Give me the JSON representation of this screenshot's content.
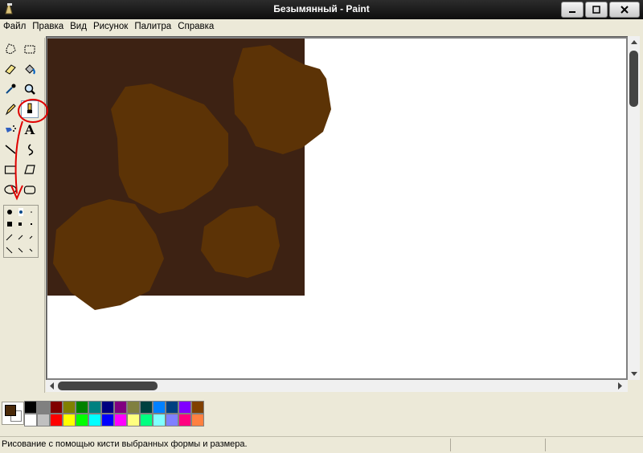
{
  "window": {
    "title": "Безымянный - Paint",
    "icons": {
      "app": "paint-app-icon",
      "minimize": "minimize-icon",
      "maximize": "maximize-icon",
      "close": "close-icon"
    }
  },
  "menu": [
    "Файл",
    "Правка",
    "Вид",
    "Рисунок",
    "Палитра",
    "Справка"
  ],
  "tools": [
    {
      "name": "free-form-select",
      "icon": "free-form-select-icon"
    },
    {
      "name": "select",
      "icon": "rectangle-select-icon"
    },
    {
      "name": "eraser",
      "icon": "eraser-icon"
    },
    {
      "name": "fill",
      "icon": "paint-bucket-icon"
    },
    {
      "name": "pick-color",
      "icon": "eyedropper-icon"
    },
    {
      "name": "magnifier",
      "icon": "magnifier-icon"
    },
    {
      "name": "pencil",
      "icon": "pencil-icon"
    },
    {
      "name": "brush",
      "icon": "brush-icon",
      "selected": true
    },
    {
      "name": "airbrush",
      "icon": "airbrush-icon"
    },
    {
      "name": "text",
      "icon": "text-icon",
      "glyph": "A"
    },
    {
      "name": "line",
      "icon": "line-icon"
    },
    {
      "name": "curve",
      "icon": "curve-icon"
    },
    {
      "name": "rectangle",
      "icon": "rectangle-icon"
    },
    {
      "name": "polygon",
      "icon": "polygon-icon"
    },
    {
      "name": "ellipse",
      "icon": "ellipse-icon"
    },
    {
      "name": "rounded-rectangle",
      "icon": "rounded-rectangle-icon"
    }
  ],
  "annotation": {
    "highlight_color": "#e00000",
    "points_to": "brush-shape-options"
  },
  "colors": {
    "foreground": "#4b2a0a",
    "background": "#ffffff",
    "canvas_dark": "#3d2213",
    "canvas_blob": "#5c3306",
    "canvas_white": "#ffffff",
    "palette": [
      "#000000",
      "#808080",
      "#800000",
      "#808000",
      "#008000",
      "#008080",
      "#000080",
      "#800080",
      "#808040",
      "#004040",
      "#0080ff",
      "#004080",
      "#8000ff",
      "#804000",
      "#ffffff",
      "#c0c0c0",
      "#ff0000",
      "#ffff00",
      "#00ff00",
      "#00ffff",
      "#0000ff",
      "#ff00ff",
      "#ffff80",
      "#00ff80",
      "#80ffff",
      "#8080ff",
      "#ff0080",
      "#ff8040"
    ]
  },
  "status": {
    "text": "Рисование с помощью кисти выбранных формы и размера."
  }
}
